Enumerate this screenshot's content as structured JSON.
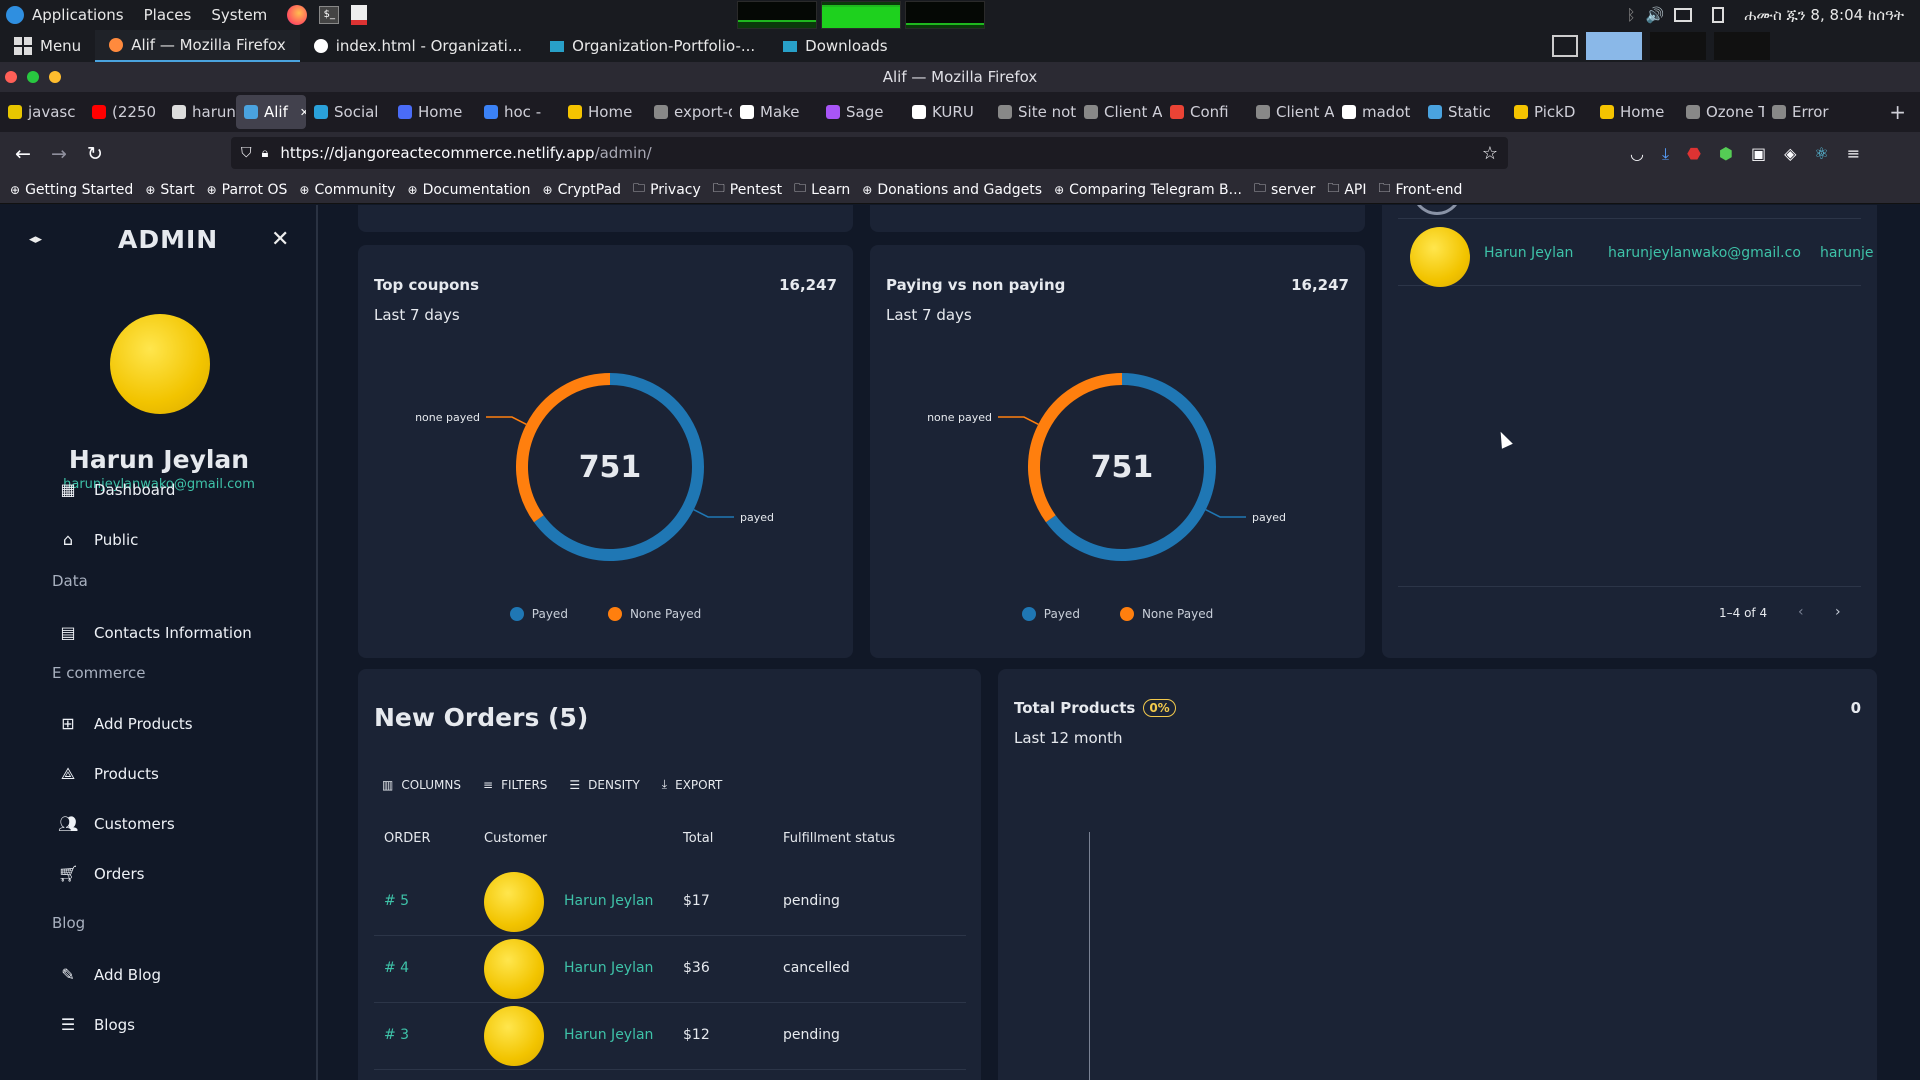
{
  "system_panel": {
    "applications": "Applications",
    "places": "Places",
    "system": "System",
    "clock": "ሐሙስ ጁን  8, 8:04 ከሰዓት"
  },
  "taskbar": {
    "menu": "Menu",
    "tasks": [
      "Alif — Mozilla Firefox",
      "index.html - Organizati...",
      "Organization-Portfolio-...",
      "Downloads"
    ]
  },
  "browser": {
    "window_title": "Alif — Mozilla Firefox",
    "tabs": [
      "javasc",
      "(2250",
      "harun",
      "Alif",
      "Social",
      "Home",
      "hoc - ",
      "Home",
      "export-dc",
      "Make ",
      "Sage ",
      "KURU",
      "Site not fo",
      "Client Are",
      "Confi",
      "Client Are",
      "madot",
      "Static",
      "PickD",
      "Home",
      "Ozone Te",
      "Error"
    ],
    "url_host": "https://djangoreactecommerce.netlify.app",
    "url_path": "/admin/",
    "bookmarks": [
      "Getting Started",
      "Start",
      "Parrot OS",
      "Community",
      "Documentation",
      "CryptPad",
      "Privacy",
      "Pentest",
      "Learn",
      "Donations and Gadgets",
      "Comparing Telegram B...",
      "server",
      "API",
      "Front-end"
    ]
  },
  "sidebar": {
    "title": "ADMIN",
    "user_name": "Harun Jeylan",
    "user_email": "harunjeylanwako@gmail.com",
    "items": [
      {
        "label": "Dashboard",
        "icon": "dashboard-icon"
      },
      {
        "label": "Public",
        "icon": "home-icon"
      },
      {
        "section": "Data"
      },
      {
        "label": "Contacts Information",
        "icon": "contacts-icon"
      },
      {
        "section": "E commerce"
      },
      {
        "label": "Add Products",
        "icon": "add-box-icon"
      },
      {
        "label": "Products",
        "icon": "category-icon"
      },
      {
        "label": "Customers",
        "icon": "people-icon"
      },
      {
        "label": "Orders",
        "icon": "cart-icon"
      },
      {
        "section": "Blog"
      },
      {
        "label": "Add Blog",
        "icon": "post-add-icon"
      },
      {
        "label": "Blogs",
        "icon": "list-icon"
      }
    ]
  },
  "top_coupons": {
    "title": "Top coupons",
    "total": "16,247",
    "period": "Last 7 days",
    "center": "751",
    "label_none": "none payed",
    "label_payed": "payed",
    "legend_payed": "Payed",
    "legend_none": "None Payed"
  },
  "paying": {
    "title": "Paying vs non paying",
    "total": "16,247",
    "period": "Last 7 days",
    "center": "751",
    "label_none": "none payed",
    "label_payed": "payed",
    "legend_payed": "Payed",
    "legend_none": "None Payed"
  },
  "chart_data": [
    {
      "type": "pie",
      "title": "Top coupons",
      "categories": [
        "Payed",
        "None Payed"
      ],
      "values": [
        65,
        35
      ],
      "center_text": "751",
      "colors": [
        "#1f77b4",
        "#ff7f0e"
      ]
    },
    {
      "type": "pie",
      "title": "Paying vs non paying",
      "categories": [
        "Payed",
        "None Payed"
      ],
      "values": [
        65,
        35
      ],
      "center_text": "751",
      "colors": [
        "#1f77b4",
        "#ff7f0e"
      ]
    }
  ],
  "users_card": {
    "row_name": "Harun Jeylan",
    "row_email": "harunjeylanwako@gmail.co",
    "row_user": "harunje",
    "pagination": "1–4 of 4"
  },
  "orders": {
    "title": "New Orders (5)",
    "toolbar": {
      "columns": "COLUMNS",
      "filters": "FILTERS",
      "density": "DENSITY",
      "export": "EXPORT"
    },
    "headers": {
      "order": "ORDER",
      "customer": "Customer",
      "total": "Total",
      "status": "Fulfillment status"
    },
    "rows": [
      {
        "order": "# 5",
        "customer": "Harun Jeylan",
        "total": "$17",
        "status": "pending"
      },
      {
        "order": "# 4",
        "customer": "Harun Jeylan",
        "total": "$36",
        "status": "cancelled"
      },
      {
        "order": "# 3",
        "customer": "Harun Jeylan",
        "total": "$12",
        "status": "pending"
      }
    ]
  },
  "total_products": {
    "title": "Total Products",
    "badge": "0%",
    "value": "0",
    "period": "Last 12 month"
  },
  "colors": {
    "accent": "#3ec2a8",
    "payed": "#1f77b4",
    "none_payed": "#ff7f0e",
    "card": "#1b2335",
    "bg": "#111827"
  }
}
